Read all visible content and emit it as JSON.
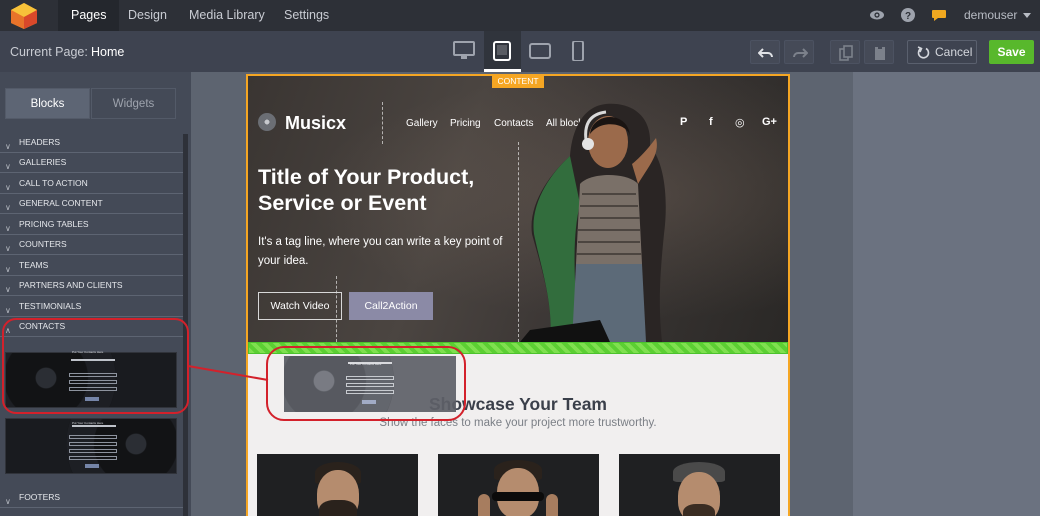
{
  "topnav": {
    "tabs": [
      {
        "label": "Pages",
        "active": true
      },
      {
        "label": "Design",
        "active": false
      },
      {
        "label": "Media Library",
        "active": false
      },
      {
        "label": "Settings",
        "active": false
      }
    ],
    "username": "demouser",
    "icons": [
      "logo-icon",
      "eye-icon",
      "help-icon",
      "chat-icon",
      "chevron-down-icon"
    ]
  },
  "toolbar": {
    "current_page_label": "Current Page:",
    "current_page_value": "Home",
    "devices": [
      {
        "name": "desktop",
        "active": false
      },
      {
        "name": "tablet",
        "active": true
      },
      {
        "name": "tablet-landscape",
        "active": false
      },
      {
        "name": "mobile",
        "active": false
      }
    ],
    "cancel_label": "Cancel",
    "save_label": "Save"
  },
  "sidebar": {
    "tabs": [
      {
        "label": "Blocks",
        "active": true
      },
      {
        "label": "Widgets",
        "active": false
      }
    ],
    "categories": [
      "HEADERS",
      "GALLERIES",
      "CALL TO ACTION",
      "GENERAL CONTENT",
      "PRICING TABLES",
      "COUNTERS",
      "TEAMS",
      "PARTNERS AND CLIENTS",
      "TESTIMONIALS",
      "CONTACTS"
    ],
    "expanded_category": "CONTACTS",
    "thumbnail_titles": [
      "Put Your Contacts Here",
      "Put Your Contacts Here"
    ],
    "footer_category": "FOOTERS"
  },
  "canvas": {
    "content_tag": "CONTENT",
    "hero": {
      "brand": "Musicx",
      "nav": [
        "Gallery",
        "Pricing",
        "Contacts",
        "All blocks"
      ],
      "social": [
        "P",
        "f",
        "◎",
        "G+"
      ],
      "title": "Title of Your Product, Service or Event",
      "tagline": "It's a tag line, where you can write a key point of your idea.",
      "button_primary": "Watch Video",
      "button_secondary": "Call2Action"
    },
    "team": {
      "title": "Showcase Your Team",
      "subtitle": "Show the faces to make your project more trustworthy."
    },
    "drag_ghost_title": "Put Your Contacts Here"
  },
  "colors": {
    "topnav_bg": "#2d3037",
    "toolbar_bg": "#3e4350",
    "sidebar_bg": "#444a57",
    "accent_orange": "#f5a623",
    "save_green": "#58b82c",
    "dropzone_green": "#5ccf33",
    "annotation_red": "#d3212b",
    "cta_purple": "#8b8aa6"
  }
}
